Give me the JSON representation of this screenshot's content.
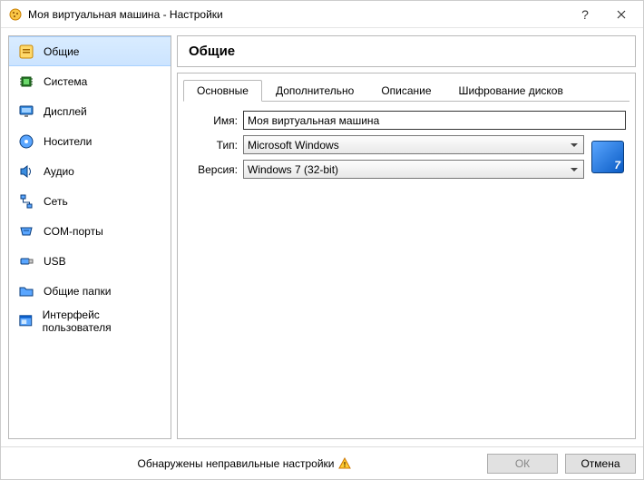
{
  "titlebar": {
    "title": "Моя виртуальная машина - Настройки"
  },
  "sidebar": {
    "items": [
      {
        "label": "Общие",
        "active": true
      },
      {
        "label": "Система"
      },
      {
        "label": "Дисплей"
      },
      {
        "label": "Носители"
      },
      {
        "label": "Аудио"
      },
      {
        "label": "Сеть"
      },
      {
        "label": "COM-порты"
      },
      {
        "label": "USB"
      },
      {
        "label": "Общие папки"
      },
      {
        "label": "Интерфейс пользователя"
      }
    ]
  },
  "main": {
    "heading": "Общие",
    "tabs": [
      {
        "label": "Основные",
        "active": true
      },
      {
        "label": "Дополнительно"
      },
      {
        "label": "Описание"
      },
      {
        "label": "Шифрование дисков"
      }
    ],
    "form": {
      "name_label": "Имя:",
      "name_value": "Моя виртуальная машина",
      "type_label": "Тип:",
      "type_value": "Microsoft Windows",
      "version_label": "Версия:",
      "version_value": "Windows 7 (32-bit)",
      "os_badge": "7"
    }
  },
  "footer": {
    "status": "Обнаружены неправильные настройки",
    "ok": "ОК",
    "cancel": "Отмена"
  }
}
